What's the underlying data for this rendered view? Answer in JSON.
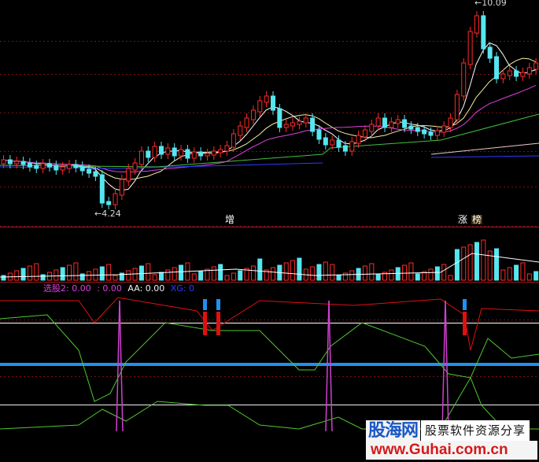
{
  "colors": {
    "background": "#000000",
    "grid": "#7a1010",
    "candle_up": "#ff2a2a",
    "candle_down": "#56e6f0",
    "ma5": "#ffffff",
    "ma10": "#f4f0a0",
    "ma20": "#e040e0",
    "ma60": "#40c040",
    "ma120": "#2c3cff",
    "ind_red": "#e01010",
    "ind_green": "#50c830",
    "ind_magenta": "#d040d0",
    "ind_blue_level": "#2090f0"
  },
  "price_panel": {
    "high_label": "10.09",
    "low_label": "4.24",
    "tag_increase": "增",
    "tag_rise": "涨",
    "tag_rank": "榜"
  },
  "indicator_panel": {
    "parts": [
      {
        "text": "选股2: 0.00",
        "color": "#e040e0"
      },
      {
        "text": ": 0.00",
        "color": "#e040e0"
      },
      {
        "text": "AA: 0.00",
        "color": "#f0f0f0"
      },
      {
        "text": "XG: 0",
        "color": "#2c3cff"
      }
    ]
  },
  "watermark": {
    "logo_text": "股海网",
    "slogan_text": "股票软件资源分享",
    "url_text": "www.Guhai.com.cn"
  }
}
